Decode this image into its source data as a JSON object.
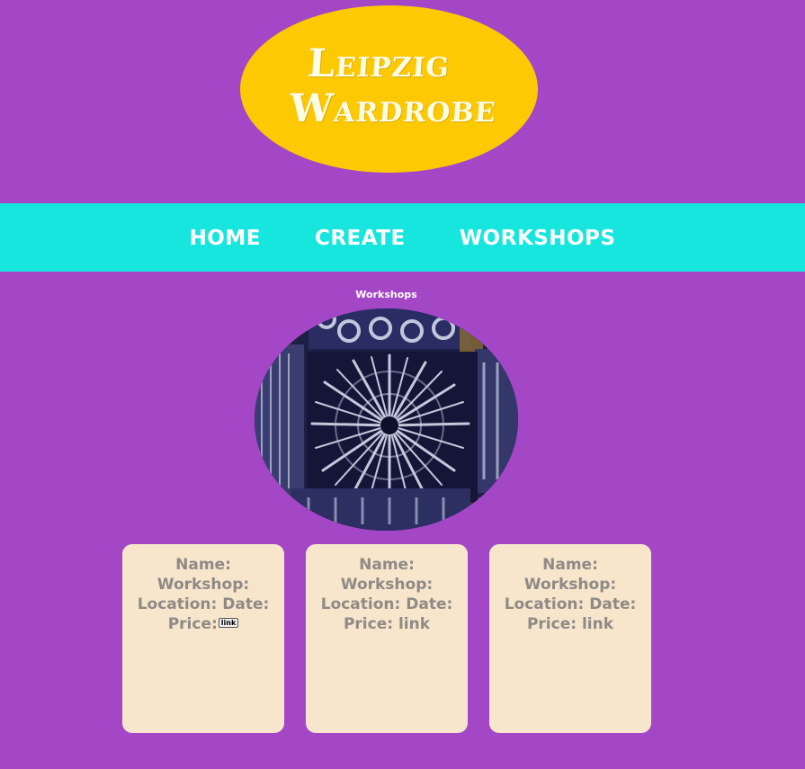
{
  "logo": {
    "line1": "Leipzig",
    "line2": "Wardrobe"
  },
  "nav": {
    "items": [
      {
        "label": "HOME"
      },
      {
        "label": "CREATE"
      },
      {
        "label": "WORKSHOPS"
      }
    ]
  },
  "page": {
    "title": "Workshops"
  },
  "hero": {
    "icon": "tie-dye-fabric-photo"
  },
  "cards": [
    {
      "name_label": "Name:",
      "workshop_label": "Workshop:",
      "location_label": "Location:",
      "date_label": "Date:",
      "price_label": "Price:",
      "link_label": "link"
    },
    {
      "name_label": "Name:",
      "workshop_label": "Workshop:",
      "location_label": "Location:",
      "date_label": "Date:",
      "price_label": "Price:",
      "link_label": "link"
    },
    {
      "name_label": "Name:",
      "workshop_label": "Workshop:",
      "location_label": "Location:",
      "date_label": "Date:",
      "price_label": "Price:",
      "link_label": "link"
    }
  ],
  "colors": {
    "background": "#a347c6",
    "logo": "#fdc903",
    "nav": "#17e6df",
    "card": "#f7e6cb",
    "card_text": "#8f8a86"
  }
}
